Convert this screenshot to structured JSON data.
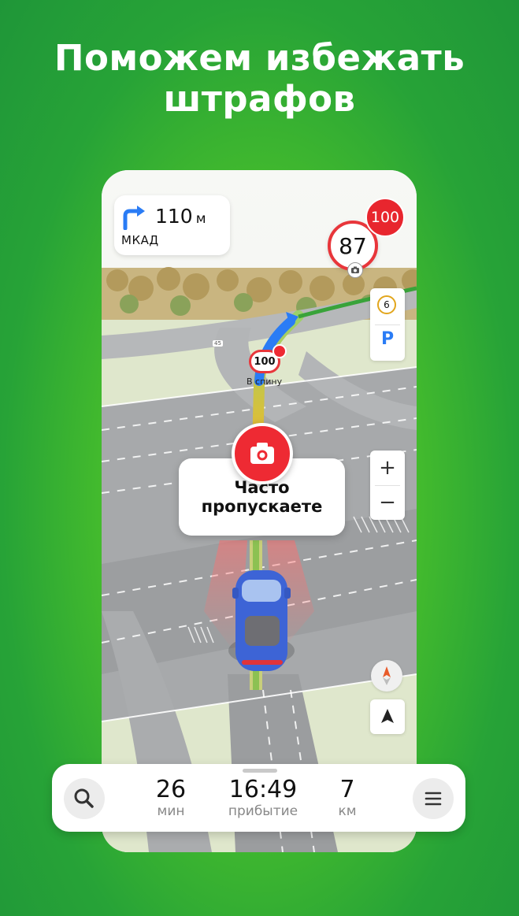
{
  "headline": {
    "line1": "Поможем избежать",
    "line2": "штрафов"
  },
  "navigation": {
    "maneuver": {
      "distance": "110",
      "unit": "м",
      "road": "МКАД",
      "icon": "turn-right-icon"
    },
    "current_speed": "87",
    "speed_limit": "100",
    "road_sign": {
      "limit": "100",
      "label": "В спину"
    },
    "road_number": "45",
    "poi_badge": "6",
    "parking_label": "P",
    "zoom": {
      "in": "+",
      "out": "−"
    },
    "hint": {
      "line1": "Часто",
      "line2": "пропускаете"
    },
    "colors": {
      "brand_green": "#27a337",
      "alert_red": "#ee2a33",
      "route_blue": "#2a7cf5"
    }
  },
  "trip": {
    "time_value": "26",
    "time_label": "мин",
    "arrival_value": "16:49",
    "arrival_label": "прибытие",
    "distance_value": "7",
    "distance_label": "км"
  }
}
